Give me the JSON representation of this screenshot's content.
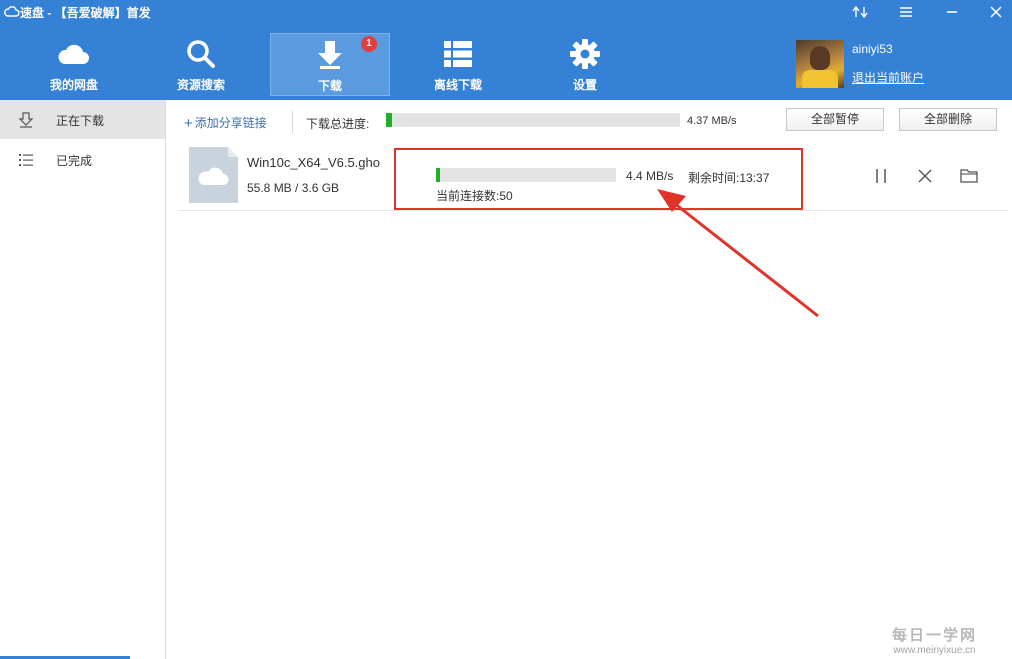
{
  "window": {
    "title": "速盘 - 【吾爱破解】首发"
  },
  "nav": {
    "items": [
      {
        "label": "我的网盘",
        "icon": "cloud-icon"
      },
      {
        "label": "资源搜索",
        "icon": "search-icon"
      },
      {
        "label": "下载",
        "icon": "download-icon",
        "badge": "1",
        "active": true
      },
      {
        "label": "离线下载",
        "icon": "list-icon"
      },
      {
        "label": "设置",
        "icon": "gear-icon"
      }
    ]
  },
  "user": {
    "name": "ainiyi53",
    "logout_label": "退出当前账户"
  },
  "sidebar": {
    "items": [
      {
        "label": "正在下载",
        "icon": "download-tray-icon",
        "active": true
      },
      {
        "label": "已完成",
        "icon": "list-bullets-icon"
      }
    ]
  },
  "toolbar": {
    "add_link_label": "添加分享链接",
    "total_progress_label": "下载总进度:",
    "total_progress": 0.02,
    "total_speed": "4.37 MB/s",
    "pause_all_label": "全部暂停",
    "delete_all_label": "全部删除"
  },
  "downloads": [
    {
      "file_name": "Win10c_X64_V6.5.gho",
      "size_text": "55.8 MB / 3.6 GB",
      "progress": 0.02,
      "speed": "4.4 MB/s",
      "remaining": "剩余时间:13:37",
      "connections": "当前连接数:50"
    }
  ],
  "watermark": {
    "main": "每日一学网",
    "sub": "www.meiriyixue.cn"
  },
  "colors": {
    "header": "#3481d5",
    "progress": "#22b028",
    "annotation": "#e0332a"
  }
}
